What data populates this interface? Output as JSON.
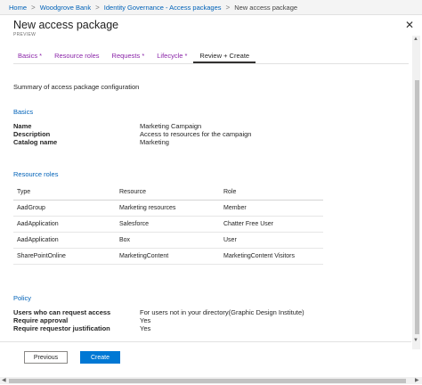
{
  "breadcrumb": {
    "items": [
      "Home",
      "Woodgrove Bank",
      "Identity Governance - Access packages"
    ],
    "current": "New access package",
    "separator": ">"
  },
  "panel": {
    "title": "New access package",
    "subtitle": "PREVIEW",
    "close_icon": "close-icon"
  },
  "tabs": [
    "Basics *",
    "Resource roles",
    "Requests *",
    "Lifecycle *",
    "Review + Create"
  ],
  "active_tab": "Review + Create",
  "summary_text": "Summary of access package configuration",
  "basics": {
    "heading": "Basics",
    "rows": [
      {
        "key": "Name",
        "value": "Marketing Campaign"
      },
      {
        "key": "Description",
        "value": "Access to resources for the campaign"
      },
      {
        "key": "Catalog name",
        "value": "Marketing"
      }
    ]
  },
  "resource_roles": {
    "heading": "Resource roles",
    "columns": [
      "Type",
      "Resource",
      "Role"
    ],
    "rows": [
      [
        "AadGroup",
        "Marketing resources",
        "Member"
      ],
      [
        "AadApplication",
        "Salesforce",
        "Chatter Free User"
      ],
      [
        "AadApplication",
        "Box",
        "User"
      ],
      [
        "SharePointOnline",
        "MarketingContent",
        "MarketingContent Visitors"
      ]
    ]
  },
  "policy": {
    "heading": "Policy",
    "rows": [
      {
        "key": "Users who can request access",
        "value": "For users not in your directory(Graphic Design Institute)"
      },
      {
        "key": "Require approval",
        "value": "Yes"
      },
      {
        "key": "Require requestor justification",
        "value": "Yes"
      }
    ]
  },
  "footer": {
    "previous_label": "Previous",
    "create_label": "Create"
  },
  "colors": {
    "link": "#0062b8",
    "tab_required": "#8a24a8",
    "primary_button": "#0078d4"
  }
}
